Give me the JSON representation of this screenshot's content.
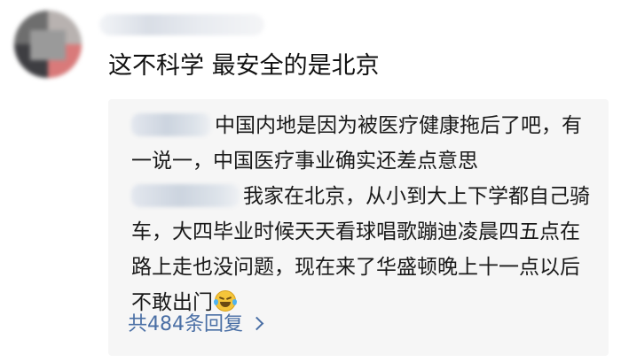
{
  "comment": {
    "text": "这不科学 最安全的是北京"
  },
  "replies": [
    {
      "text": "中国内地是因为被医疗健康拖后了吧，有一说一，中国医疗事业确实还差点意思"
    },
    {
      "text": "我家在北京，从小到大上下学都自己骑车，大四毕业时候天天看球唱歌蹦迪凌晨四五点在路上走也没问题，现在来了华盛顿晚上十一点以后不敢出门",
      "emoji": "crying-laughing-emoji"
    }
  ],
  "reply_count_label": "共484条回复"
}
